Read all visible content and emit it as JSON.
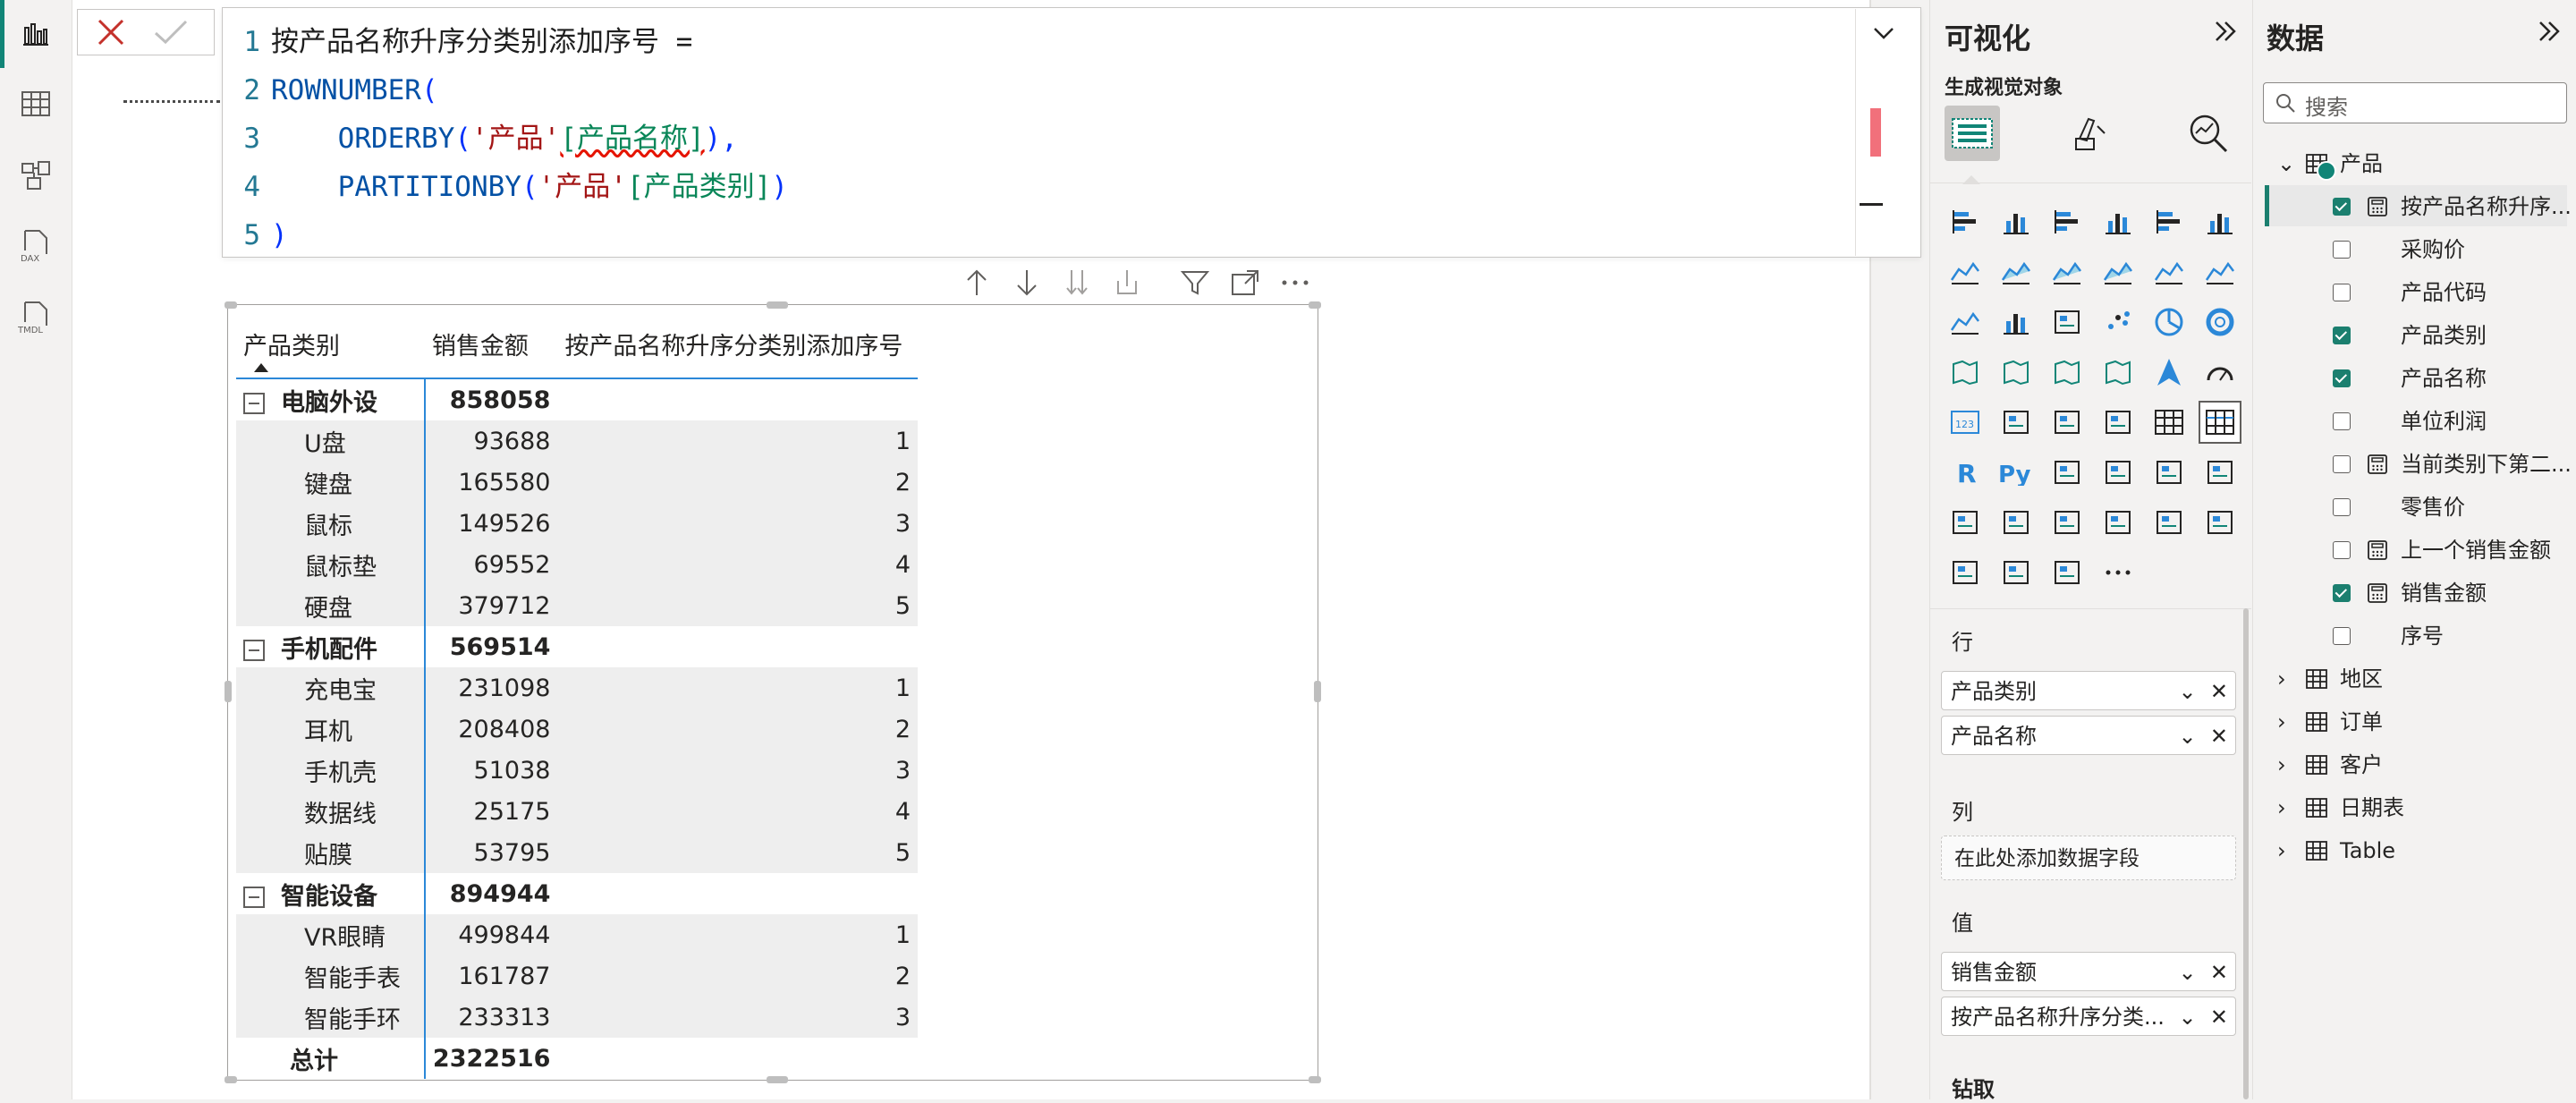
{
  "formula": {
    "lines": [
      {
        "n": "1",
        "a": "按产品名称升序分类别添加序号 ="
      },
      {
        "n": "2",
        "kw": "ROWNUMBER",
        "p": "("
      },
      {
        "n": "3",
        "kw": "ORDERBY",
        "p1": "(",
        "t": "'产品'",
        "c": "[产品名称]",
        "p2": "),"
      },
      {
        "n": "4",
        "kw": "PARTITIONBY",
        "p1": "(",
        "t": "'产品'",
        "c": "[产品类别]",
        "p2": ")"
      },
      {
        "n": "5",
        "p": ")"
      }
    ]
  },
  "table": {
    "headers": [
      "产品类别",
      "销售金额",
      "按产品名称升序分类别添加序号"
    ],
    "groups": [
      {
        "name": "电脑外设",
        "total": "858058",
        "rows": [
          [
            "U盘",
            "93688",
            "1"
          ],
          [
            "键盘",
            "165580",
            "2"
          ],
          [
            "鼠标",
            "149526",
            "3"
          ],
          [
            "鼠标垫",
            "69552",
            "4"
          ],
          [
            "硬盘",
            "379712",
            "5"
          ]
        ]
      },
      {
        "name": "手机配件",
        "total": "569514",
        "rows": [
          [
            "充电宝",
            "231098",
            "1"
          ],
          [
            "耳机",
            "208408",
            "2"
          ],
          [
            "手机壳",
            "51038",
            "3"
          ],
          [
            "数据线",
            "25175",
            "4"
          ],
          [
            "贴膜",
            "53795",
            "5"
          ]
        ]
      },
      {
        "name": "智能设备",
        "total": "894944",
        "rows": [
          [
            "VR眼睛",
            "499844",
            "1"
          ],
          [
            "智能手表",
            "161787",
            "2"
          ],
          [
            "智能手环",
            "233313",
            "3"
          ]
        ]
      }
    ],
    "grand_total_label": "总计",
    "grand_total": "2322516"
  },
  "viz_panel": {
    "title": "可视化",
    "build_label": "生成视觉对象",
    "rows_label": "行",
    "rows_fields": [
      "产品类别",
      "产品名称"
    ],
    "columns_label": "列",
    "columns_placeholder": "在此处添加数据字段",
    "values_label": "值",
    "values_fields": [
      "销售金额",
      "按产品名称升序分类..."
    ],
    "drill_label": "钻取",
    "more": "···"
  },
  "data_panel": {
    "title": "数据",
    "search_placeholder": "搜索",
    "tables": [
      {
        "name": "产品",
        "expanded": true,
        "fields": [
          {
            "name": "按产品名称升序...",
            "checked": true,
            "calc": true
          },
          {
            "name": "采购价",
            "checked": false,
            "calc": false
          },
          {
            "name": "产品代码",
            "checked": false,
            "calc": false
          },
          {
            "name": "产品类别",
            "checked": true,
            "calc": false
          },
          {
            "name": "产品名称",
            "checked": true,
            "calc": false
          },
          {
            "name": "单位利润",
            "checked": false,
            "calc": false
          },
          {
            "name": "当前类别下第二...",
            "checked": false,
            "calc": true
          },
          {
            "name": "零售价",
            "checked": false,
            "calc": false
          },
          {
            "name": "上一个销售金额",
            "checked": false,
            "calc": true
          },
          {
            "name": "销售金额",
            "checked": true,
            "calc": true
          },
          {
            "name": "序号",
            "checked": false,
            "calc": false
          }
        ]
      },
      {
        "name": "地区"
      },
      {
        "name": "订单"
      },
      {
        "name": "客户"
      },
      {
        "name": "日期表"
      },
      {
        "name": "Table"
      }
    ]
  },
  "rail": {
    "dax_label": "DAX",
    "tmdl_label": "TMDL"
  },
  "colors": {
    "accent": "#118577",
    "selection": "#2b88d8",
    "error": "#e51400"
  }
}
